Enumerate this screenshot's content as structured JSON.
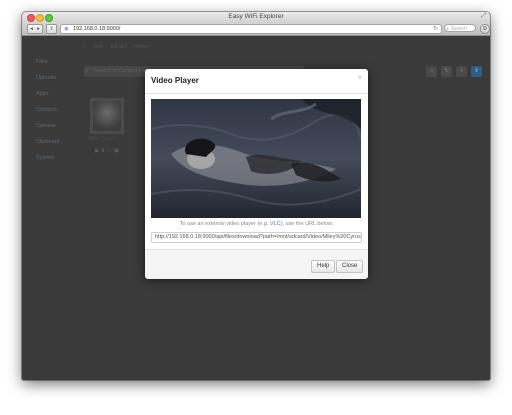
{
  "window": {
    "title": "Easy WiFi Explorer"
  },
  "browser": {
    "url": "192.168.0.18:9000/",
    "search_placeholder": "Search",
    "back_glyph": "◂",
    "forward_glyph": "▸",
    "share_glyph": "⇪",
    "reload_glyph": "↻",
    "gear_glyph": "⚙"
  },
  "sidebar": {
    "items": [
      {
        "label": "Files"
      },
      {
        "label": "Uploads"
      },
      {
        "label": "Apps"
      },
      {
        "label": "Contacts"
      },
      {
        "label": "Camera"
      },
      {
        "label": "Clipboard"
      },
      {
        "label": "System"
      }
    ]
  },
  "main": {
    "breadcrumbs": [
      "mnt",
      "sdcard",
      "Video"
    ],
    "filter_placeholder": "Search in Current Folder",
    "file": {
      "name": "Miley Cyrus - ..."
    },
    "tools": [
      "⌂",
      "↻",
      "+",
      "⇩"
    ]
  },
  "modal": {
    "title": "Video Player",
    "close_glyph": "×",
    "caption_before": "To use an external video player (e.g. ",
    "caption_link": "VLC",
    "caption_after": "), use the URL below:",
    "url": "http://192.168.0.18:9000/api/files/download?path=/mnt/sdcard/Video/Miley%20Cyrus%20-%20...",
    "help_label": "Help",
    "close_label": "Close"
  },
  "colors": {
    "accent": "#3a7bd0",
    "overlay": "#3a3a3a"
  }
}
